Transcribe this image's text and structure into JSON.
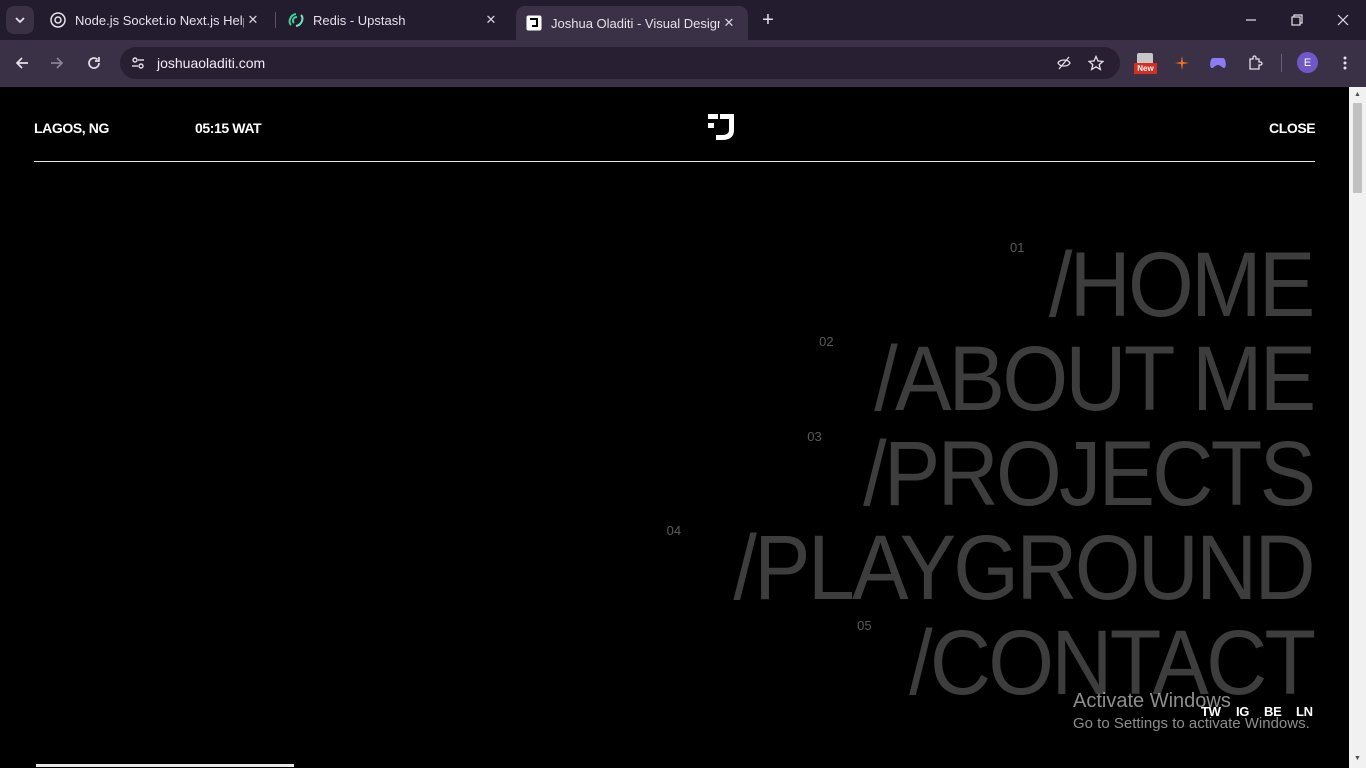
{
  "browser": {
    "tabs": [
      {
        "title": "Node.js Socket.io Next.js Help",
        "icon": "chatgpt-icon",
        "active": false
      },
      {
        "title": "Redis - Upstash",
        "icon": "upstash-icon",
        "active": false
      },
      {
        "title": "Joshua Oladiti - Visual Designer",
        "icon": "site-favicon-icon",
        "active": true
      }
    ],
    "url": "joshuaoladiti.com",
    "extension_badge": "New",
    "profile_initial": "E"
  },
  "site": {
    "location": "LAGOS, NG",
    "time": "05:15 WAT",
    "close_label": "CLOSE",
    "menu": [
      {
        "number": "01",
        "label": "/HOME"
      },
      {
        "number": "02",
        "label": "/ABOUT ME"
      },
      {
        "number": "03",
        "label": "/PROJECTS"
      },
      {
        "number": "04",
        "label": "/PLAYGROUND"
      },
      {
        "number": "05",
        "label": "/CONTACT"
      }
    ],
    "social": [
      "TW",
      "IG",
      "BE",
      "LN"
    ]
  },
  "os_watermark": {
    "title": "Activate Windows",
    "subtitle": "Go to Settings to activate Windows."
  },
  "colors": {
    "tabbar": "#231b2e",
    "toolbar": "#3b3147",
    "page_bg": "#000000",
    "menu_text": "#3d3d3d",
    "header_text": "#ffffff"
  }
}
